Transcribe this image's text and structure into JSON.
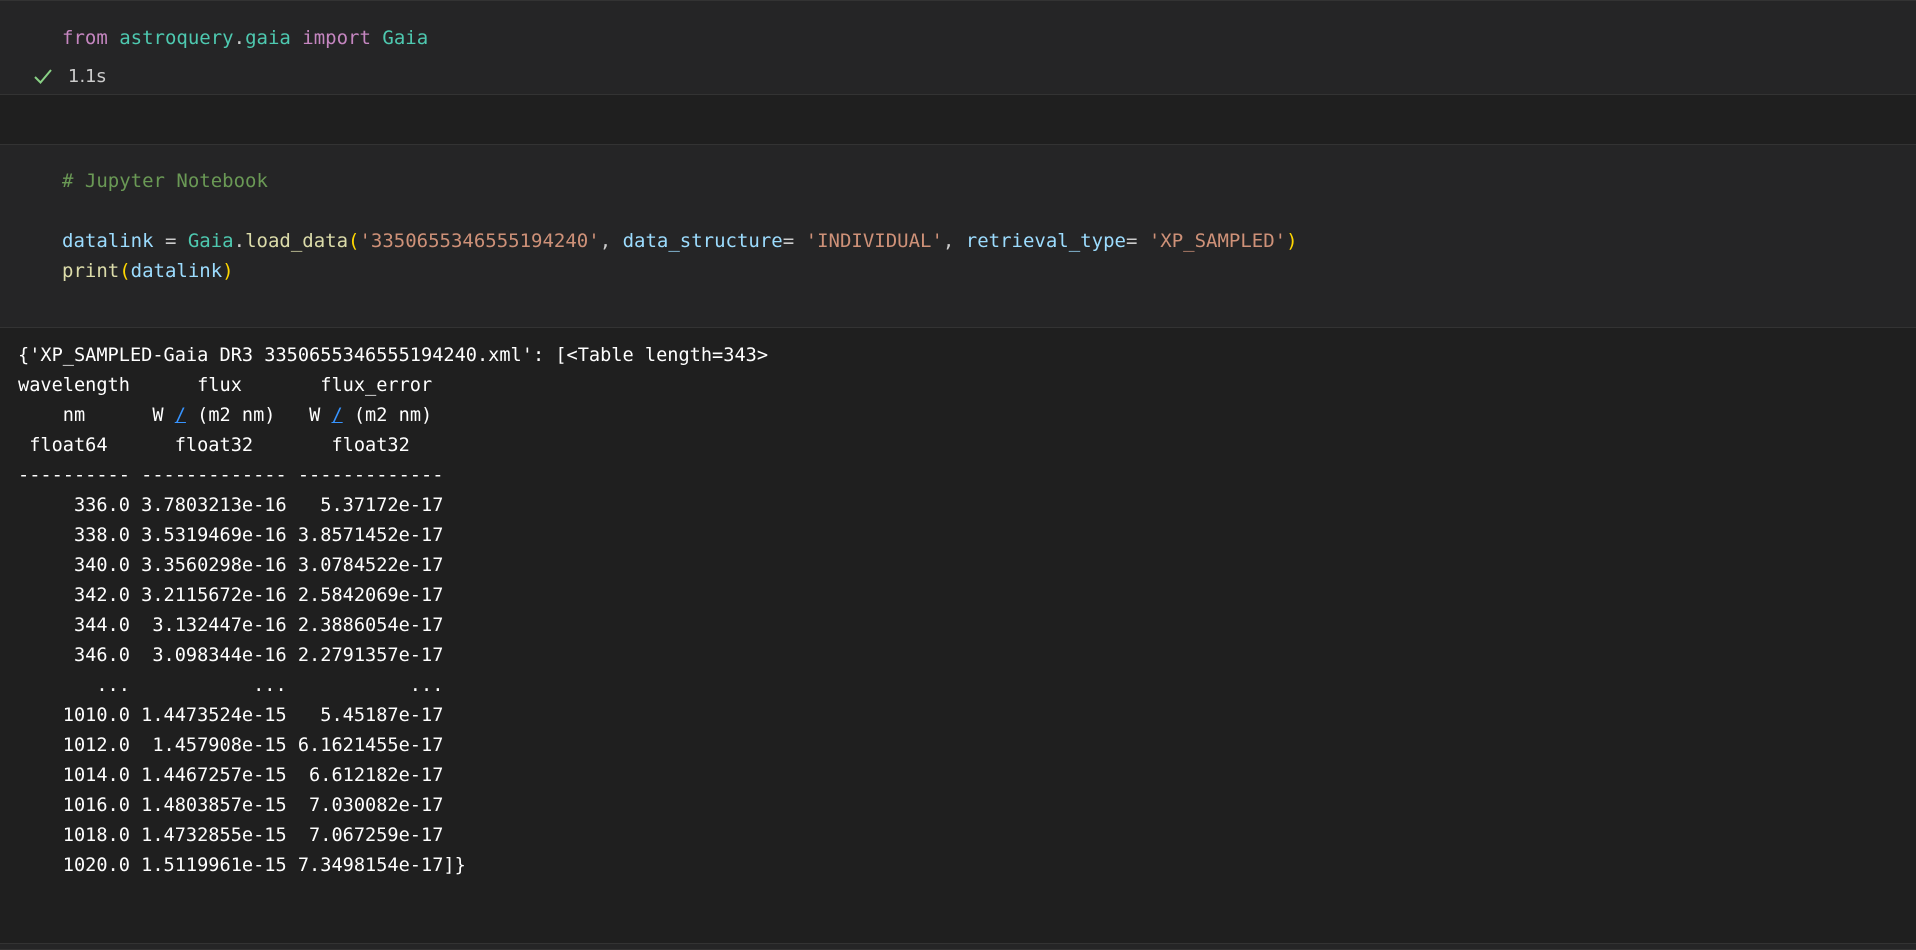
{
  "cell1": {
    "code": {
      "kw_from": "from",
      "module": "astroquery",
      "dot": ".",
      "submodule": "gaia",
      "kw_import": "import",
      "name": "Gaia"
    },
    "status": {
      "icon": "checkmark-icon",
      "duration": "1.1s"
    }
  },
  "cell2": {
    "comment": "# Jupyter Notebook",
    "line2": {
      "var": "datalink",
      "eq": " = ",
      "cls": "Gaia",
      "dot": ".",
      "fn": "load_data",
      "open": "(",
      "arg1": "'3350655346555194240'",
      "sep1": ", ",
      "kw1": "data_structure",
      "eq1": "= ",
      "val1": "'INDIVIDUAL'",
      "sep2": ", ",
      "kw2": "retrieval_type",
      "eq2": "= ",
      "val2": "'XP_SAMPLED'",
      "close": ")"
    },
    "line3": {
      "fn": "print",
      "open": "(",
      "arg": "datalink",
      "close": ")"
    }
  },
  "output": {
    "header": "{'XP_SAMPLED-Gaia DR3 3350655346555194240.xml': [<Table length=343>",
    "col_names": "wavelength      flux       flux_error",
    "units": {
      "pre1": "    nm      W ",
      "link1": "/",
      "mid1": " (m2 nm)   W ",
      "link2": "/",
      "post": " (m2 nm)"
    },
    "dtypes": " float64      float32       float32",
    "separator": "---------- ------------- -------------",
    "rows": [
      "     336.0 3.7803213e-16   5.37172e-17",
      "     338.0 3.5319469e-16 3.8571452e-17",
      "     340.0 3.3560298e-16 3.0784522e-17",
      "     342.0 3.2115672e-16 2.5842069e-17",
      "     344.0  3.132447e-16 2.3886054e-17",
      "     346.0  3.098344e-16 2.2791357e-17",
      "       ...           ...           ...",
      "    1010.0 1.4473524e-15   5.45187e-17",
      "    1012.0  1.457908e-15 6.1621455e-17",
      "    1014.0 1.4467257e-15  6.612182e-17",
      "    1016.0 1.4803857e-15  7.030082e-17",
      "    1018.0 1.4732855e-15  7.067259e-17",
      "    1020.0 1.5119961e-15 7.3498154e-17]}"
    ]
  },
  "colors": {
    "background": "#1f1f1f",
    "cell_background": "#252526",
    "keyword": "#c586c0",
    "class": "#4ec9b0",
    "variable": "#9cdcfe",
    "function": "#dcdcaa",
    "string": "#ce9178",
    "comment": "#6a9955",
    "link": "#3794ff",
    "success": "#89d185"
  }
}
